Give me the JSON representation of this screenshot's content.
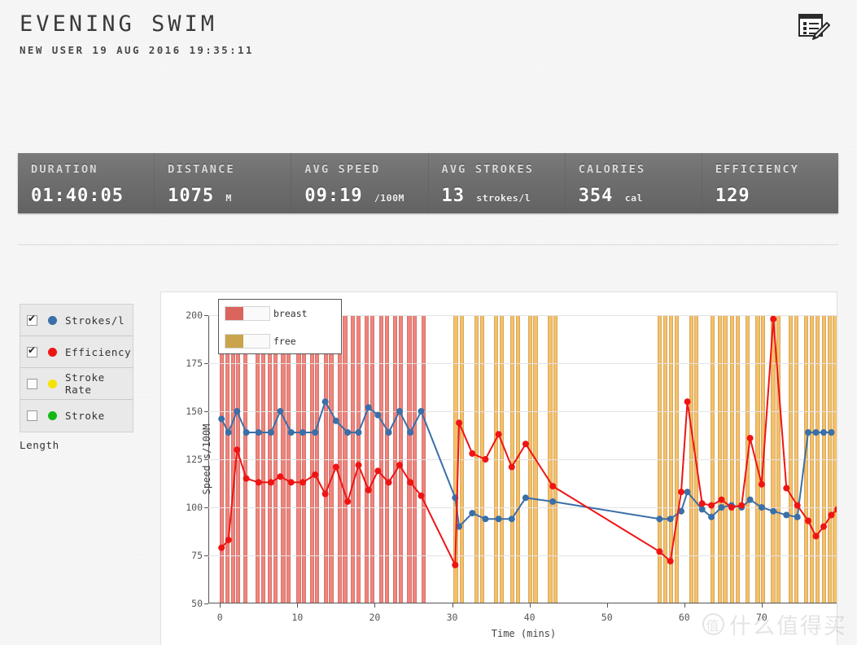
{
  "header": {
    "title": "EVENING SWIM",
    "subtitle": "NEW USER 19 AUG 2016 19:35:11",
    "edit_icon": "note-edit-icon"
  },
  "stats": [
    {
      "label": "DURATION",
      "value": "01:40:05",
      "unit": ""
    },
    {
      "label": "DISTANCE",
      "value": "1075",
      "unit": "M"
    },
    {
      "label": "AVG SPEED",
      "value": "09:19",
      "unit": "/100M"
    },
    {
      "label": "AVG STROKES",
      "value": "13",
      "unit": "strokes/l"
    },
    {
      "label": "CALORIES",
      "value": "354",
      "unit": "cal"
    },
    {
      "label": "EFFICIENCY",
      "value": "129",
      "unit": ""
    }
  ],
  "series_selector": {
    "items": [
      {
        "label": "Strokes/l",
        "color": "#3a6fa8",
        "checked": true
      },
      {
        "label": "Efficiency",
        "color": "#ef1414",
        "checked": true
      },
      {
        "label": "Stroke Rate",
        "color": "#f5e400",
        "checked": false
      },
      {
        "label": "Stroke",
        "color": "#14b814",
        "checked": false
      }
    ],
    "footer_label": "Length"
  },
  "chart_legend": [
    {
      "label": "breast",
      "color": "#d9655e"
    },
    {
      "label": "free",
      "color": "#c9a44a"
    }
  ],
  "watermark": {
    "mark": "值",
    "text": "什么值得买"
  },
  "chart_data": {
    "type": "line",
    "title": "",
    "xlabel": "Time (mins)",
    "ylabel": "Speed s/100M",
    "xlim": [
      -1.5,
      80
    ],
    "ylim": [
      50,
      200
    ],
    "yticks": [
      50,
      75,
      100,
      125,
      150,
      175,
      200
    ],
    "xticks": [
      0,
      10,
      20,
      30,
      40,
      50,
      60,
      70
    ],
    "grid": true,
    "legend_position": "top-left-inside",
    "series": [
      {
        "name": "Strokes/l",
        "color": "#3a6fa8",
        "points": [
          [
            0.2,
            146
          ],
          [
            1.1,
            139
          ],
          [
            2.2,
            150
          ],
          [
            3.4,
            139
          ],
          [
            5.0,
            139
          ],
          [
            6.6,
            139
          ],
          [
            7.8,
            150
          ],
          [
            9.2,
            139
          ],
          [
            10.7,
            139
          ],
          [
            12.3,
            139
          ],
          [
            13.6,
            155
          ],
          [
            15.0,
            145
          ],
          [
            16.5,
            139
          ],
          [
            17.9,
            139
          ],
          [
            19.2,
            152
          ],
          [
            20.4,
            148
          ],
          [
            21.8,
            139
          ],
          [
            23.2,
            150
          ],
          [
            24.6,
            139
          ],
          [
            26.0,
            150
          ],
          [
            30.4,
            105
          ],
          [
            30.9,
            90
          ],
          [
            32.6,
            97
          ],
          [
            34.3,
            94
          ],
          [
            36.0,
            94
          ],
          [
            37.7,
            94
          ],
          [
            39.5,
            105
          ],
          [
            43.0,
            103
          ],
          [
            56.8,
            94
          ],
          [
            58.2,
            94
          ],
          [
            59.6,
            98
          ],
          [
            60.4,
            108
          ],
          [
            62.3,
            99
          ],
          [
            63.5,
            95
          ],
          [
            64.8,
            100
          ],
          [
            66.1,
            101
          ],
          [
            67.4,
            100
          ],
          [
            68.5,
            104
          ],
          [
            70.0,
            100
          ],
          [
            71.5,
            98
          ],
          [
            73.2,
            96
          ],
          [
            74.6,
            95
          ],
          [
            76.0,
            139
          ],
          [
            77.0,
            139
          ],
          [
            78.0,
            139
          ],
          [
            79.0,
            139
          ]
        ]
      },
      {
        "name": "Efficiency",
        "color": "#ef1414",
        "points": [
          [
            0.2,
            79
          ],
          [
            1.1,
            83
          ],
          [
            2.2,
            130
          ],
          [
            3.4,
            115
          ],
          [
            5.0,
            113
          ],
          [
            6.6,
            113
          ],
          [
            7.8,
            116
          ],
          [
            9.2,
            113
          ],
          [
            10.7,
            113
          ],
          [
            12.3,
            117
          ],
          [
            13.6,
            107
          ],
          [
            15.0,
            121
          ],
          [
            16.5,
            103
          ],
          [
            17.9,
            122
          ],
          [
            19.2,
            109
          ],
          [
            20.4,
            119
          ],
          [
            21.8,
            113
          ],
          [
            23.2,
            122
          ],
          [
            24.6,
            113
          ],
          [
            26.0,
            106
          ],
          [
            30.4,
            70
          ],
          [
            30.9,
            144
          ],
          [
            32.6,
            128
          ],
          [
            34.3,
            125
          ],
          [
            36.0,
            138
          ],
          [
            37.7,
            121
          ],
          [
            39.5,
            133
          ],
          [
            43.0,
            111
          ],
          [
            56.8,
            77
          ],
          [
            58.2,
            72
          ],
          [
            59.6,
            108
          ],
          [
            60.4,
            155
          ],
          [
            62.3,
            102
          ],
          [
            63.5,
            101
          ],
          [
            64.8,
            104
          ],
          [
            66.1,
            100
          ],
          [
            67.4,
            101
          ],
          [
            68.5,
            136
          ],
          [
            70.0,
            112
          ],
          [
            71.5,
            198
          ],
          [
            73.2,
            110
          ],
          [
            74.6,
            101
          ],
          [
            76.0,
            93
          ],
          [
            77.0,
            85
          ],
          [
            78.0,
            90
          ],
          [
            79.0,
            96
          ],
          [
            79.8,
            99
          ]
        ]
      }
    ],
    "bars": {
      "breast": {
        "color": "#f0847c",
        "ranges": [
          [
            0.0,
            0.55
          ],
          [
            0.7,
            1.25
          ],
          [
            1.4,
            1.95
          ],
          [
            2.1,
            2.65
          ],
          [
            3.0,
            3.55
          ],
          [
            4.6,
            5.15
          ],
          [
            5.3,
            5.85
          ],
          [
            6.2,
            6.75
          ],
          [
            6.9,
            7.45
          ],
          [
            7.9,
            8.45
          ],
          [
            8.6,
            9.15
          ],
          [
            9.9,
            10.45
          ],
          [
            10.6,
            11.15
          ],
          [
            11.6,
            12.15
          ],
          [
            12.3,
            12.85
          ],
          [
            13.4,
            13.95
          ],
          [
            14.1,
            14.65
          ],
          [
            15.2,
            15.75
          ],
          [
            15.9,
            16.45
          ],
          [
            16.9,
            17.45
          ],
          [
            17.6,
            18.15
          ],
          [
            18.7,
            19.25
          ],
          [
            19.4,
            19.95
          ],
          [
            20.6,
            21.15
          ],
          [
            21.3,
            21.85
          ],
          [
            22.4,
            22.95
          ],
          [
            23.1,
            23.65
          ],
          [
            24.2,
            24.75
          ],
          [
            24.9,
            25.45
          ],
          [
            26.0,
            26.55
          ]
        ]
      },
      "free": {
        "color": "#f5c069",
        "ranges": [
          [
            30.2,
            30.75
          ],
          [
            30.95,
            31.5
          ],
          [
            32.9,
            33.45
          ],
          [
            33.6,
            34.15
          ],
          [
            35.4,
            35.95
          ],
          [
            36.1,
            36.65
          ],
          [
            37.5,
            38.05
          ],
          [
            38.2,
            38.75
          ],
          [
            39.8,
            40.35
          ],
          [
            40.5,
            41.05
          ],
          [
            42.4,
            42.95
          ],
          [
            43.1,
            43.65
          ],
          [
            56.5,
            57.05
          ],
          [
            57.3,
            57.85
          ],
          [
            58.0,
            58.55
          ],
          [
            58.75,
            59.3
          ],
          [
            60.6,
            61.15
          ],
          [
            61.3,
            61.85
          ],
          [
            63.4,
            63.95
          ],
          [
            64.3,
            64.85
          ],
          [
            65.0,
            65.55
          ],
          [
            65.9,
            66.45
          ],
          [
            66.6,
            67.15
          ],
          [
            67.9,
            68.45
          ],
          [
            69.2,
            69.75
          ],
          [
            69.9,
            70.45
          ],
          [
            71.2,
            71.75
          ],
          [
            71.9,
            72.45
          ],
          [
            73.5,
            74.05
          ],
          [
            74.2,
            74.75
          ],
          [
            75.5,
            76.05
          ],
          [
            76.2,
            76.75
          ],
          [
            76.9,
            77.45
          ],
          [
            77.8,
            78.35
          ],
          [
            78.5,
            79.05
          ],
          [
            79.2,
            79.75
          ]
        ]
      }
    }
  }
}
